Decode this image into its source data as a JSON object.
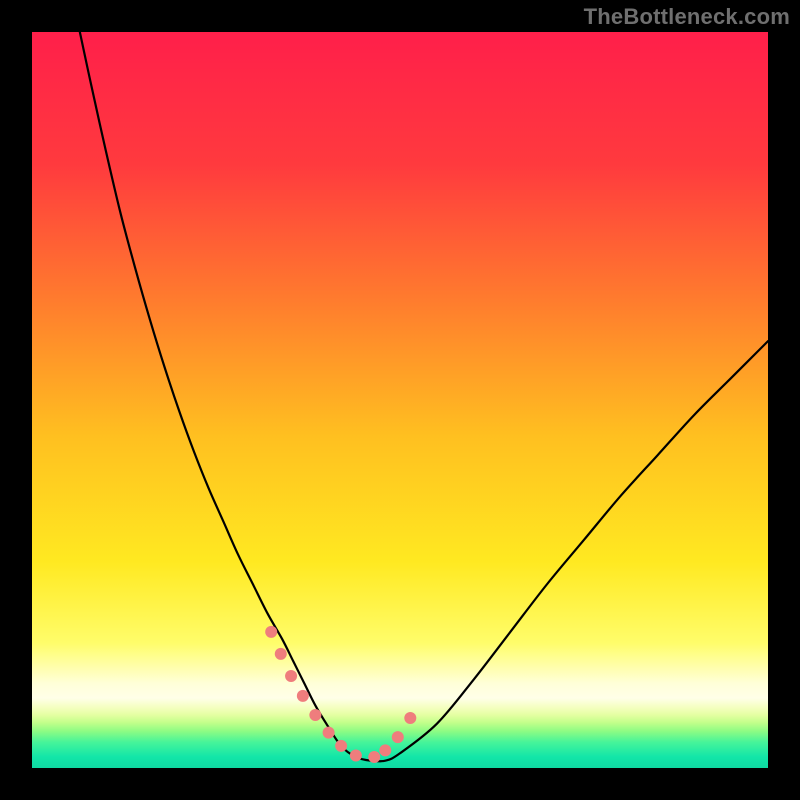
{
  "watermark": "TheBottleneck.com",
  "colors": {
    "black": "#000000",
    "watermark": "#6f6f6f",
    "curve": "#000000",
    "marker": "#ef7d7d",
    "gradient_stops": [
      {
        "offset": 0.0,
        "color": "#ff1f4a"
      },
      {
        "offset": 0.18,
        "color": "#ff3a3e"
      },
      {
        "offset": 0.36,
        "color": "#ff7a2e"
      },
      {
        "offset": 0.55,
        "color": "#ffc020"
      },
      {
        "offset": 0.72,
        "color": "#ffe921"
      },
      {
        "offset": 0.83,
        "color": "#fffd6a"
      },
      {
        "offset": 0.885,
        "color": "#ffffd8"
      },
      {
        "offset": 0.905,
        "color": "#ffffe8"
      },
      {
        "offset": 0.918,
        "color": "#f4ffbf"
      },
      {
        "offset": 0.928,
        "color": "#e4ffa2"
      },
      {
        "offset": 0.938,
        "color": "#c4ff8b"
      },
      {
        "offset": 0.95,
        "color": "#8dfc84"
      },
      {
        "offset": 0.965,
        "color": "#46f49a"
      },
      {
        "offset": 0.985,
        "color": "#12e6a8"
      },
      {
        "offset": 1.0,
        "color": "#0fd9a2"
      }
    ]
  },
  "chart_data": {
    "type": "line",
    "title": "",
    "xlabel": "",
    "ylabel": "",
    "xlim": [
      0,
      100
    ],
    "ylim": [
      0,
      100
    ],
    "series": [
      {
        "name": "bottleneck-curve",
        "x": [
          6.5,
          8,
          10,
          12,
          14,
          16,
          18,
          20,
          22,
          24,
          26,
          28,
          30,
          32,
          34,
          35.5,
          37,
          38.5,
          40,
          42,
          44,
          46,
          48,
          50,
          55,
          60,
          65,
          70,
          75,
          80,
          85,
          90,
          95,
          100
        ],
        "y": [
          100,
          93,
          84,
          75.5,
          68,
          61,
          54.5,
          48.5,
          43,
          38,
          33.5,
          29,
          25,
          21,
          17.5,
          14.5,
          11.5,
          8.5,
          6,
          3,
          1.5,
          1,
          1,
          2,
          6,
          12,
          18.5,
          25,
          31,
          37,
          42.5,
          48,
          53,
          58
        ]
      }
    ],
    "markers": {
      "name": "valley-markers",
      "x": [
        32.5,
        33.8,
        35.2,
        36.8,
        38.5,
        40.3,
        42.0,
        44.0,
        46.5,
        48.0,
        49.7,
        51.4
      ],
      "y": [
        18.5,
        15.5,
        12.5,
        9.8,
        7.2,
        4.8,
        3.0,
        1.7,
        1.5,
        2.4,
        4.2,
        6.8
      ],
      "color": "#ef7d7d",
      "size": 12
    },
    "legend": false,
    "grid": false
  }
}
